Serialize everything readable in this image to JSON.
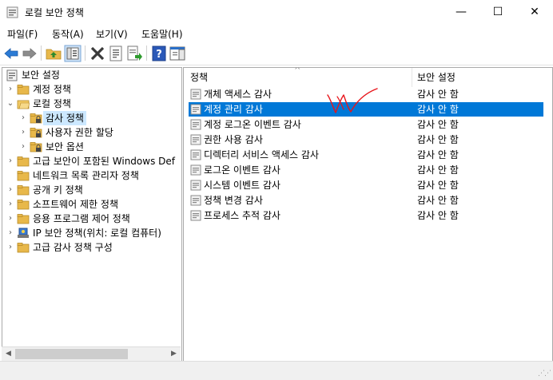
{
  "window": {
    "title": "로컬 보안 정책",
    "minimize_glyph": "—",
    "maximize_glyph": "☐",
    "close_glyph": "✕"
  },
  "menu": [
    "파일(F)",
    "동작(A)",
    "보기(V)",
    "도움말(H)"
  ],
  "toolbar": {
    "icons": [
      "back-icon",
      "forward-icon",
      "up-folder-icon",
      "show-hide-tree-icon",
      "delete-icon",
      "properties-icon",
      "export-list-icon",
      "help-icon",
      "show-action-pane-icon"
    ]
  },
  "tree": {
    "root": "보안 설정",
    "items": [
      {
        "label": "계정 정책",
        "level": 1,
        "chevron": "›",
        "icon": "folder-icon"
      },
      {
        "label": "로컬 정책",
        "level": 1,
        "chevron": "⌄",
        "icon": "folder-open-icon"
      },
      {
        "label": "감사 정책",
        "level": 2,
        "chevron": "›",
        "icon": "folder-lock-icon",
        "selected": true
      },
      {
        "label": "사용자 권한 할당",
        "level": 2,
        "chevron": "›",
        "icon": "folder-lock-icon"
      },
      {
        "label": "보안 옵션",
        "level": 2,
        "chevron": "›",
        "icon": "folder-lock-icon"
      },
      {
        "label": "고급 보안이 포함된 Windows Def",
        "level": 1,
        "chevron": "›",
        "icon": "folder-icon"
      },
      {
        "label": "네트워크 목록 관리자 정책",
        "level": 1,
        "chevron": "",
        "icon": "folder-icon"
      },
      {
        "label": "공개 키 정책",
        "level": 1,
        "chevron": "›",
        "icon": "folder-icon"
      },
      {
        "label": "소프트웨어 제한 정책",
        "level": 1,
        "chevron": "›",
        "icon": "folder-icon"
      },
      {
        "label": "응용 프로그램 제어 정책",
        "level": 1,
        "chevron": "›",
        "icon": "folder-icon"
      },
      {
        "label": "IP 보안 정책(위치: 로컬 컴퓨터)",
        "level": 1,
        "chevron": "›",
        "icon": "ip-security-icon"
      },
      {
        "label": "고급 감사 정책 구성",
        "level": 1,
        "chevron": "›",
        "icon": "folder-icon"
      }
    ]
  },
  "list": {
    "columns": [
      "정책",
      "보안 설정"
    ],
    "sort_indicator": "^",
    "rows": [
      {
        "name": "개체 액세스 감사",
        "value": "감사 안 함"
      },
      {
        "name": "계정 관리 감사",
        "value": "감사 안 함",
        "selected": true
      },
      {
        "name": "계정 로그온 이벤트 감사",
        "value": "감사 안 함"
      },
      {
        "name": "권한 사용 감사",
        "value": "감사 안 함"
      },
      {
        "name": "디렉터리 서비스 액세스 감사",
        "value": "감사 안 함"
      },
      {
        "name": "로그온 이벤트 감사",
        "value": "감사 안 함"
      },
      {
        "name": "시스템 이벤트 감사",
        "value": "감사 안 함"
      },
      {
        "name": "정책 변경 감사",
        "value": "감사 안 함"
      },
      {
        "name": "프로세스 추적 감사",
        "value": "감사 안 함"
      }
    ]
  },
  "annotation": {
    "color": "#e8141a",
    "description": "handwritten red mark"
  },
  "colors": {
    "selection": "#0078d7",
    "tree_selection": "#cce8ff",
    "folder": "#e8b84a"
  }
}
